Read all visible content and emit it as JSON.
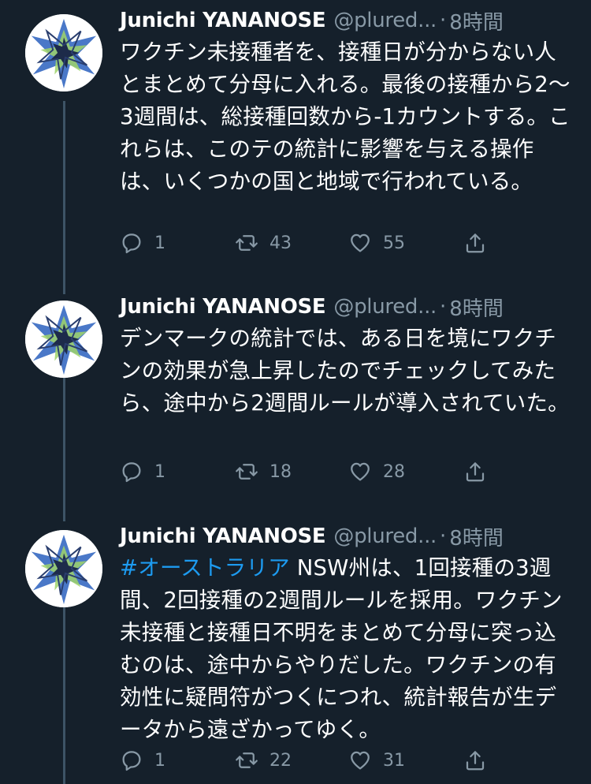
{
  "tweets": [
    {
      "name": "Junichi YANANOSE",
      "handle": "@plured...",
      "dot": "·",
      "time": "8時間",
      "hashtag": "",
      "text": "ワクチン未接種者を、接種日が分からない人とまとめて分母に入れる。最後の接種から2〜3週間は、総接種回数から-1カウントする。これらは、このテの統計に影響を与える操作は、いくつかの国と地域で行われている。",
      "reply_count": "1",
      "retweet_count": "43",
      "like_count": "55"
    },
    {
      "name": "Junichi YANANOSE",
      "handle": "@plured...",
      "dot": "·",
      "time": "8時間",
      "hashtag": "",
      "text": "デンマークの統計では、ある日を境にワクチンの効果が急上昇したのでチェックしてみたら、途中から2週間ルールが導入されていた。",
      "reply_count": "1",
      "retweet_count": "18",
      "like_count": "28"
    },
    {
      "name": "Junichi YANANOSE",
      "handle": "@plured...",
      "dot": "·",
      "time": "8時間",
      "hashtag": "#オーストラリア",
      "text": " NSW州は、1回接種の3週間、2回接種の2週間ルールを採用。ワクチン未接種と接種日不明をまとめて分母に突っ込むのは、途中からやりだした。ワクチンの有効性に疑問符がつくにつれ、統計報告が生データから遠ざかってゆく。",
      "reply_count": "1",
      "retweet_count": "22",
      "like_count": "31"
    }
  ],
  "icons": {
    "reply": "reply-icon",
    "retweet": "retweet-icon",
    "like": "heart-icon",
    "share": "share-icon",
    "more": "more-icon",
    "avatar": "avatar-polyhedron"
  },
  "colors": {
    "background": "#15202b",
    "text": "#ffffff",
    "secondary": "#8899a6",
    "link": "#1d9bf0",
    "thread_line": "#3d5466"
  }
}
